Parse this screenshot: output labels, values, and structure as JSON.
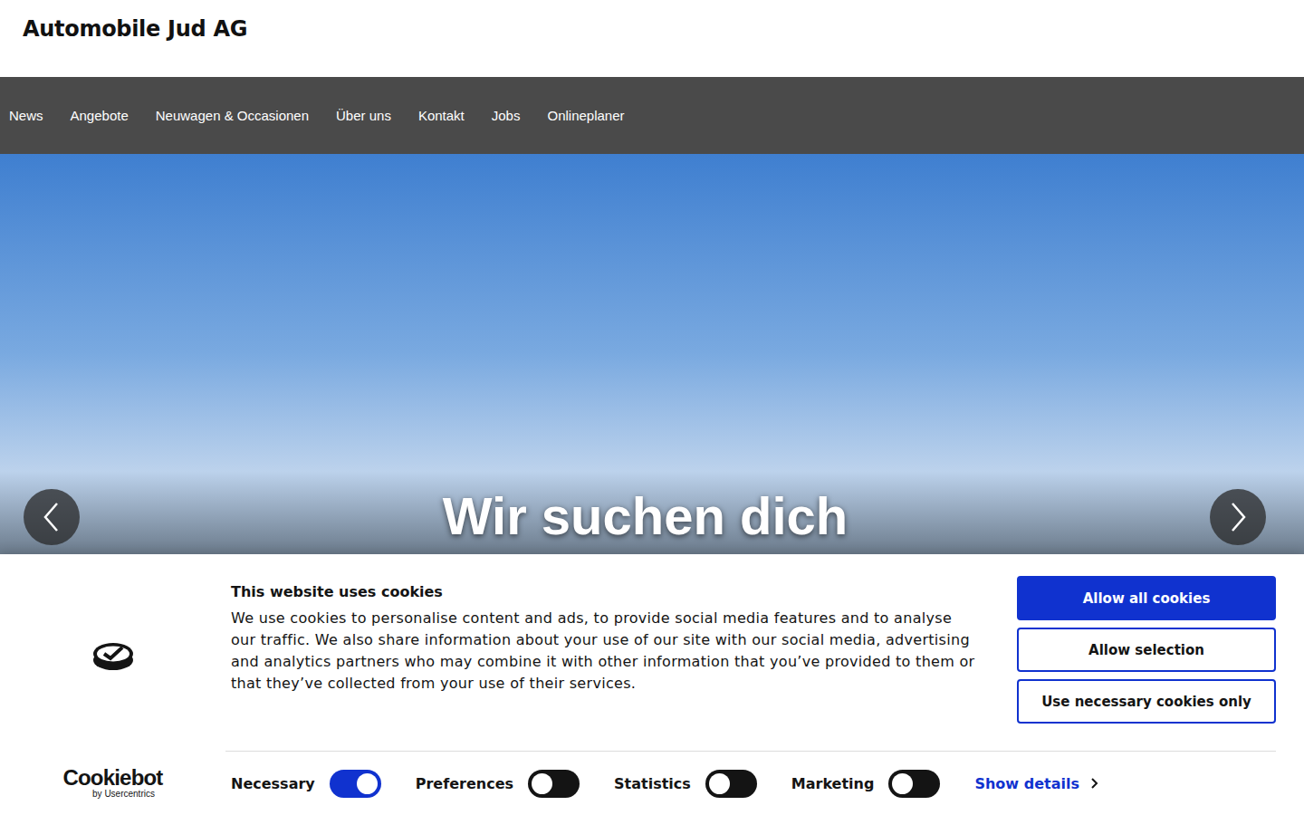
{
  "header": {
    "logo": "Automobile Jud AG"
  },
  "nav": {
    "items": [
      {
        "label": "News"
      },
      {
        "label": "Angebote"
      },
      {
        "label": "Neuwagen & Occasionen"
      },
      {
        "label": "Über uns"
      },
      {
        "label": "Kontakt"
      },
      {
        "label": "Jobs"
      },
      {
        "label": "Onlineplaner"
      }
    ]
  },
  "hero": {
    "caption": "Wir suchen dich"
  },
  "cookie_banner": {
    "title": "This website uses cookies",
    "body": "We use cookies to personalise content and ads, to provide social media features and to analyse our traffic. We also share information about your use of our site with our social media, advertising and analytics partners who may combine it with other information that you’ve provided to them or that they’ve collected from your use of their services.",
    "buttons": [
      {
        "label": "Allow all cookies",
        "kind": "primary"
      },
      {
        "label": "Allow selection",
        "kind": "outline"
      },
      {
        "label": "Use necessary cookies only",
        "kind": "outline"
      }
    ],
    "toggles": [
      {
        "label": "Necessary",
        "checked": true
      },
      {
        "label": "Preferences",
        "checked": false
      },
      {
        "label": "Statistics",
        "checked": false
      },
      {
        "label": "Marketing",
        "checked": false
      }
    ],
    "details_link": "Show details",
    "brand": {
      "name": "Cookiebot",
      "sub": "by Usercentrics"
    }
  }
}
